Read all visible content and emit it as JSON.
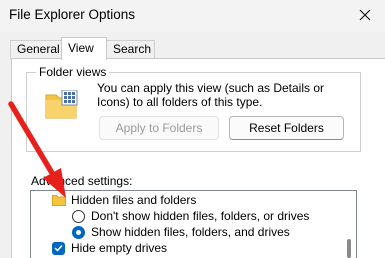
{
  "window": {
    "title": "File Explorer Options",
    "close_icon": "close-icon"
  },
  "tabs": [
    {
      "label": "General",
      "active": false
    },
    {
      "label": "View",
      "active": true
    },
    {
      "label": "Search",
      "active": false
    }
  ],
  "folder_views": {
    "group_label": "Folder views",
    "icon": "folder-view-icon",
    "description": "You can apply this view (such as Details or Icons) to all folders of this type.",
    "apply_button": {
      "label": "Apply to Folders",
      "enabled": false
    },
    "reset_button": {
      "label": "Reset Folders",
      "enabled": true
    }
  },
  "advanced_settings": {
    "label": "Advanced settings:",
    "items": [
      {
        "type": "folder",
        "label": "Hidden files and folders",
        "icon": "folder-icon"
      },
      {
        "type": "radio",
        "label": "Don't show hidden files, folders, or drives",
        "checked": false
      },
      {
        "type": "radio",
        "label": "Show hidden files, folders, and drives",
        "checked": true
      },
      {
        "type": "checkbox",
        "label": "Hide empty drives",
        "checked": true
      }
    ]
  },
  "annotation": {
    "icon": "red-arrow-icon",
    "color": "#e8201c"
  },
  "colors": {
    "accent": "#0067c0",
    "folder_yellow": "#f4c542"
  }
}
